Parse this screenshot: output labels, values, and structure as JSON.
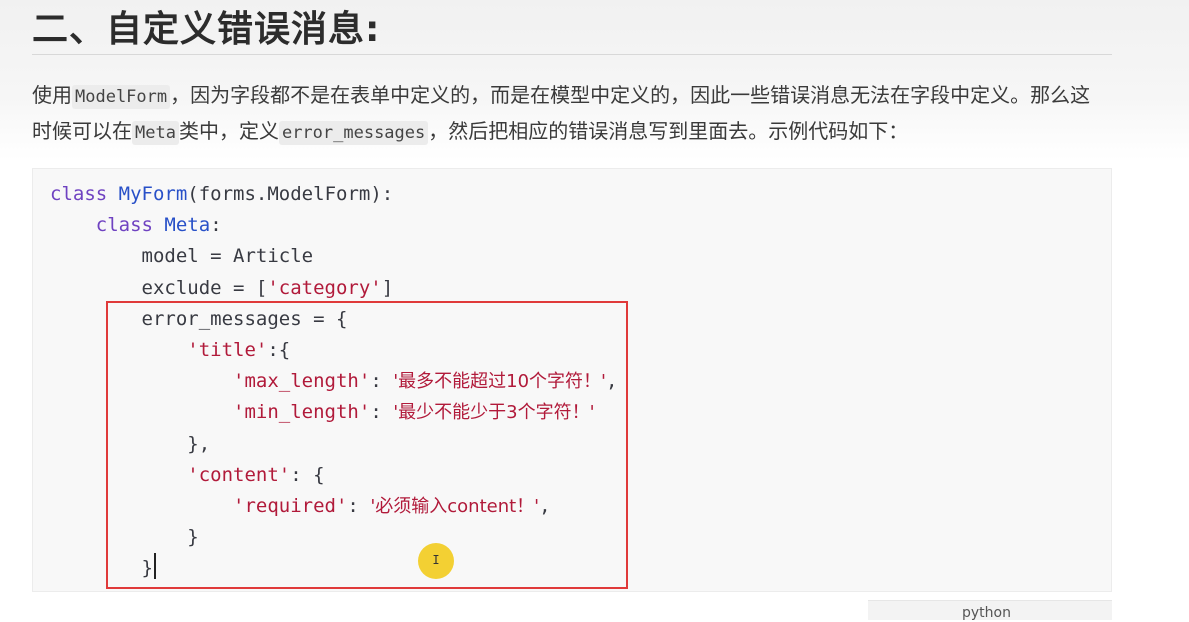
{
  "heading": "二、自定义错误消息:",
  "paragraph": {
    "t1": "使用",
    "c1": "ModelForm",
    "t2": "，因为字段都不是在表单中定义的，而是在模型中定义的，因此一些错误消息无法在字段中定义。那么这时候可以在",
    "c2": "Meta",
    "t3": "类中，定义",
    "c3": "error_messages",
    "t4": "，然后把相应的错误消息写到里面去。示例代码如下："
  },
  "code": {
    "l1_kw": "class",
    "l1_name": "MyForm",
    "l1_rest": "(forms.ModelForm):",
    "l2_kw": "class",
    "l2_name": "Meta",
    "l2_rest": ":",
    "l3": "model = Article",
    "l4_a": "exclude = [",
    "l4_s": "'category'",
    "l4_b": "]",
    "l5": "error_messages = {",
    "l6_s": "'title'",
    "l6_b": ":{",
    "l7_k": "'max_length'",
    "l7_c": ": ",
    "l7_v": "'最多不能超过10个字符！'",
    "l7_e": ",",
    "l8_k": "'min_length'",
    "l8_c": ": ",
    "l8_v": "'最少不能少于3个字符！'",
    "l9": "},",
    "l10_s": "'content'",
    "l10_b": ": {",
    "l11_k": "'required'",
    "l11_c": ": ",
    "l11_v": "'必须输入content！'",
    "l11_e": ",",
    "l12": "}",
    "l13": "}"
  },
  "language_label": "python",
  "colors": {
    "keyword": "#6f42c1",
    "class_name": "#2850c8",
    "string": "#b11a3a",
    "highlight_border": "#e03a3a",
    "cursor_dot": "#f2cb1d"
  }
}
